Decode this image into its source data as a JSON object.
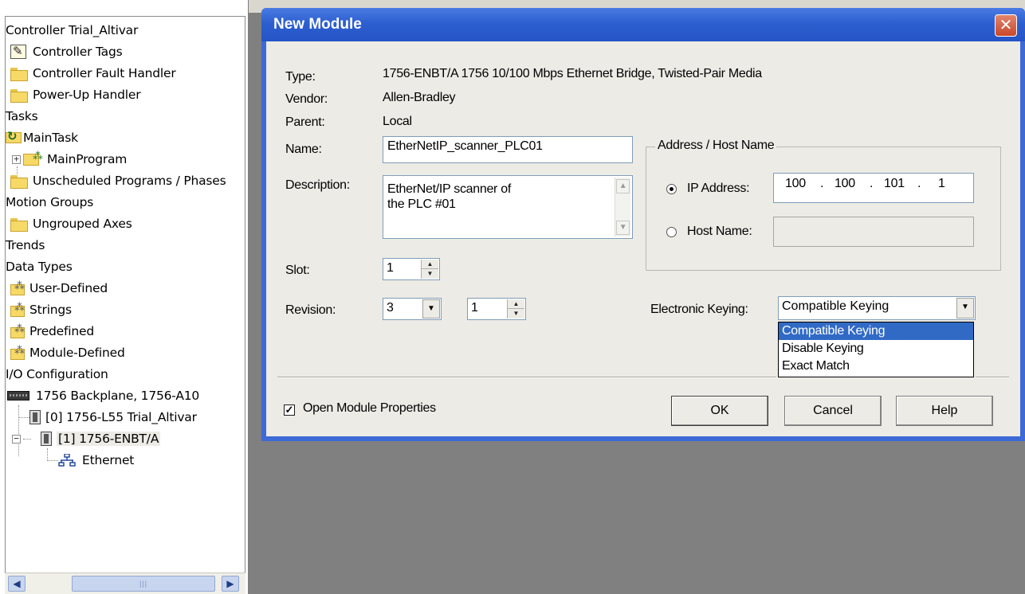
{
  "tree": {
    "root": "Controller Trial_Altivar",
    "controller_tags": "Controller Tags",
    "controller_fault_handler": "Controller Fault Handler",
    "power_up_handler": "Power-Up Handler",
    "tasks": "Tasks",
    "main_task": "MainTask",
    "main_program": "MainProgram",
    "unscheduled": "Unscheduled Programs / Phases",
    "motion_groups": "Motion Groups",
    "ungrouped_axes": "Ungrouped Axes",
    "trends": "Trends",
    "data_types": "Data Types",
    "user_defined": "User-Defined",
    "strings": "Strings",
    "predefined": "Predefined",
    "module_defined": "Module-Defined",
    "io_configuration": "I/O Configuration",
    "backplane": "1756 Backplane, 1756-A10",
    "slot0": "[0] 1756-L55 Trial_Altivar",
    "slot1": "[1] 1756-ENBT/A",
    "ethernet": "Ethernet"
  },
  "dialog": {
    "title": "New Module",
    "close_glyph": "✕",
    "type_label": "Type:",
    "type_value": "1756-ENBT/A 1756 10/100 Mbps Ethernet Bridge, Twisted-Pair Media",
    "vendor_label": "Vendor:",
    "vendor_value": "Allen-Bradley",
    "parent_label": "Parent:",
    "parent_value": "Local",
    "name_label": "Name:",
    "name_value": "EtherNetIP_scanner_PLC01",
    "description_label": "Description:",
    "description_line1": "EtherNet/IP scanner of",
    "description_line2": "the PLC #01",
    "slot_label": "Slot:",
    "slot_value": "1",
    "revision_label": "Revision:",
    "revision_major": "3",
    "revision_minor": "1",
    "address_group_title": "Address / Host Name",
    "ip_label": "IP Address:",
    "ip_octets": [
      "100",
      "100",
      "101",
      "1"
    ],
    "host_label": "Host Name:",
    "host_value": "",
    "keying_label": "Electronic Keying:",
    "keying_value": "Compatible Keying",
    "keying_options": [
      "Compatible Keying",
      "Disable Keying",
      "Exact Match"
    ],
    "open_props_label": "Open Module Properties",
    "ok_label": "OK",
    "cancel_label": "Cancel",
    "help_label": "Help"
  }
}
